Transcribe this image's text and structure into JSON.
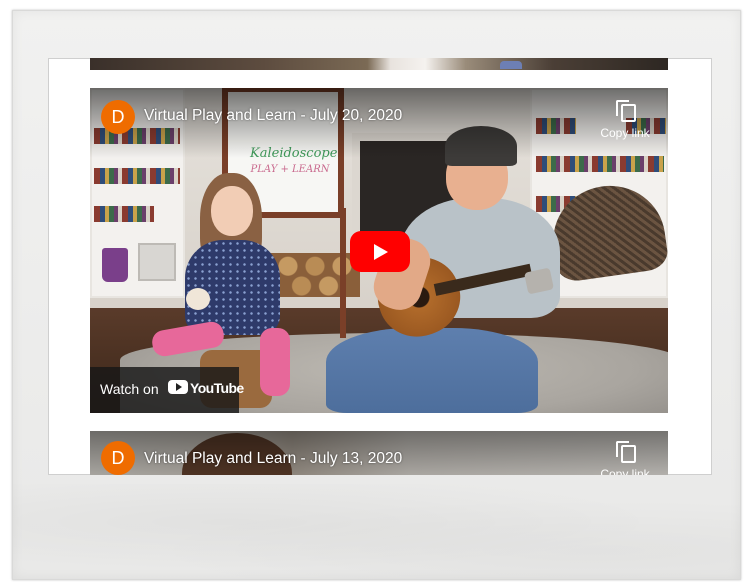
{
  "prev_video": {},
  "video_main": {
    "channel_initial": "D",
    "title": "Virtual Play and Learn - July 20, 2020",
    "copy_label": "Copy link",
    "watch_on_label": "Watch on",
    "youtube_wordmark": "YouTube",
    "easel_line1": "Kaleidoscope",
    "easel_line2": "PLAY + LEARN"
  },
  "video_second": {
    "channel_initial": "D",
    "title": "Virtual Play and Learn - July 13, 2020",
    "copy_label": "Copy link"
  },
  "colors": {
    "avatar": "#ef6c00",
    "play_button": "#ff0000",
    "frame": "#ececeb"
  }
}
